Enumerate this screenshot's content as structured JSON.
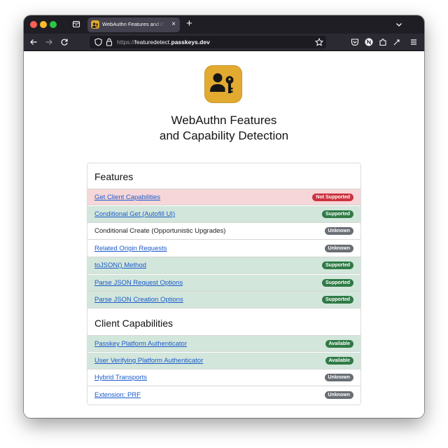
{
  "browser": {
    "tab_title": "WebAuthn Features and Capability Detection",
    "tab_close": "×",
    "new_tab": "+",
    "url_protocol": "https://",
    "url_host": "featuredetect.",
    "url_domain": "passkeys.dev",
    "colors": {
      "tabbar": "#1f1e25",
      "navbar": "#2b2a33",
      "urlbar": "#1c1b22"
    }
  },
  "page": {
    "title_line1": "WebAuthn Features",
    "title_line2": "and Capability Detection",
    "logo_color": "#e3aa30",
    "sections": {
      "features": {
        "heading": "Features",
        "rows": [
          {
            "label": "Get Client Capabilities",
            "status": "Not Supported"
          },
          {
            "label": "Conditional Get (Autofill UI)",
            "status": "Supported"
          },
          {
            "label": "Conditional Create (Opportunistic Upgrades)",
            "status": "Unknown"
          },
          {
            "label": "Related Origin Requests",
            "status": "Unknown"
          },
          {
            "label": "toJSON() Method",
            "status": "Supported"
          },
          {
            "label": "Parse JSON Request Options",
            "status": "Supported"
          },
          {
            "label": "Parse JSON Creation Options",
            "status": "Supported"
          }
        ]
      },
      "capabilities": {
        "heading": "Client Capabilities",
        "rows": [
          {
            "label": "Passkey Platform Authenticator",
            "status": "Available"
          },
          {
            "label": "User Verifying Platform Authenticator",
            "status": "Available"
          },
          {
            "label": "Hybrid Transports",
            "status": "Unknown"
          },
          {
            "label": "Extension: PRF",
            "status": "Unknown"
          }
        ]
      }
    },
    "status_colors": {
      "supported": "#2f7a45",
      "not_supported": "#cc3340",
      "unknown": "#6a6f75"
    }
  }
}
